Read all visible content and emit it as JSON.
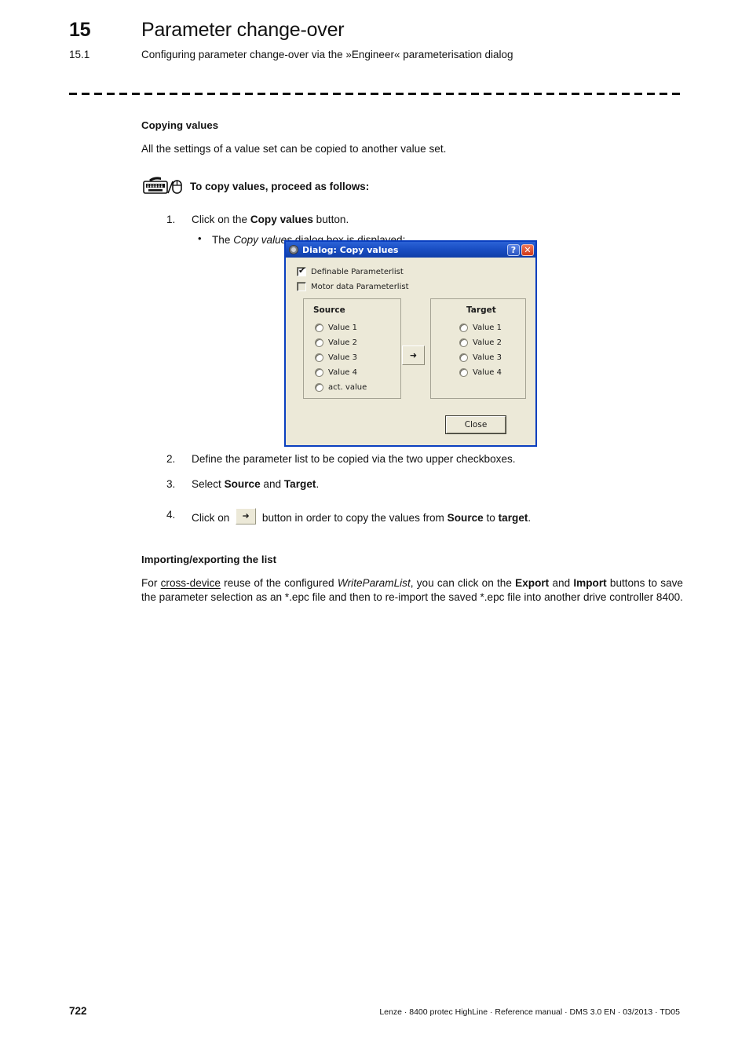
{
  "header": {
    "chapter_number": "15",
    "chapter_title": "Parameter change-over",
    "section_number": "15.1",
    "section_title": "Configuring parameter change-over via the »Engineer« parameterisation dialog"
  },
  "body": {
    "subhead_copying": "Copying values",
    "intro": "All the settings of a value set can be copied to another value set.",
    "instruction_heading": "To copy values, proceed as follows:",
    "icon_name": "keyboard-mouse-icon",
    "steps": [
      {
        "num": "1.",
        "text_before": "Click on the ",
        "bold": "Copy values",
        "text_after": " button.",
        "substep_bullet": "•",
        "substep_before": "The ",
        "substep_italic": "Copy values",
        "substep_after": " dialog box is displayed:"
      },
      {
        "num": "2.",
        "text": "Define the parameter list to be copied via the two upper checkboxes."
      },
      {
        "num": "3.",
        "text_before": "Select ",
        "bold1": "Source",
        "text_mid": " and ",
        "bold2": "Target",
        "text_after": "."
      },
      {
        "num": "4.",
        "text_before": "Click on ",
        "button_glyph": "➜",
        "text_mid": " button in order to copy the values from ",
        "bold1": "Source",
        "text_mid2": " to ",
        "bold2": "target",
        "text_after": "."
      }
    ]
  },
  "dialog": {
    "title": "Dialog: Copy values",
    "sysicon_name": "engineer-app-icon",
    "help_button": "?",
    "close_button": "✕",
    "checkboxes": [
      {
        "label": "Definable Parameterlist",
        "checked": true,
        "tick": "✔"
      },
      {
        "label": "Motor data Parameterlist",
        "checked": false,
        "tick": ""
      }
    ],
    "source": {
      "title": "Source",
      "options": [
        "Value 1",
        "Value 2",
        "Value 3",
        "Value 4",
        "act. value"
      ],
      "selected": ""
    },
    "target": {
      "title": "Target",
      "options": [
        "Value 1",
        "Value 2",
        "Value 3",
        "Value 4"
      ],
      "selected": ""
    },
    "copy_button_glyph": "➜",
    "close_label": "Close",
    "colors": {
      "titlebar": "#123FA8",
      "client_bg": "#ECE9D8",
      "border": "#0A3FBF",
      "close_btn": "#D0391A"
    }
  },
  "section2": {
    "subhead": "Importing/exporting the list",
    "p_1": "For ",
    "p_underline": "cross-device",
    "p_2": " reuse of the configured ",
    "p_italic": "WriteParamList",
    "p_3": ", you can click on the ",
    "p_bold1": "Export",
    "p_4": " and ",
    "p_bold2": "Import",
    "p_5": " buttons to save the parameter selection as an *.epc file and then to re-import the saved *.epc file into another drive controller 8400."
  },
  "footer": {
    "page_number": "722",
    "reference": "Lenze · 8400 protec HighLine · Reference manual · DMS 3.0 EN · 03/2013 · TD05"
  }
}
